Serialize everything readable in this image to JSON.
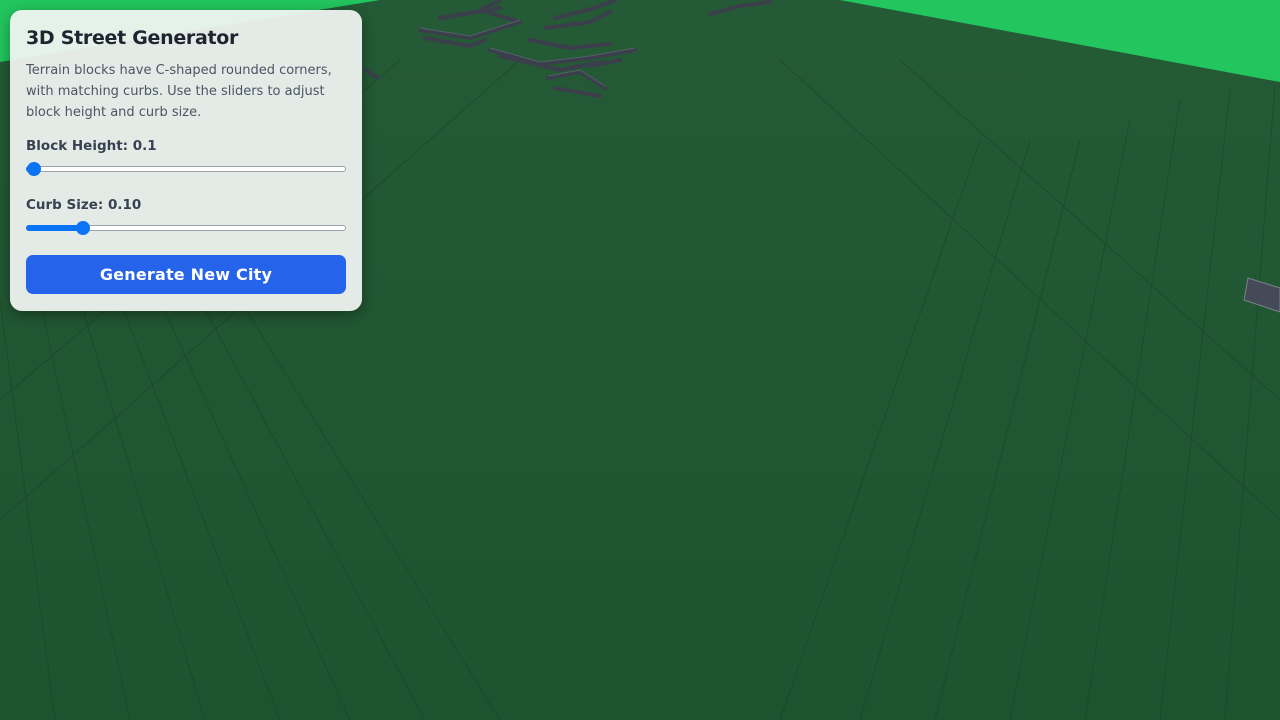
{
  "panel": {
    "title": "3D Street Generator",
    "description": "Terrain blocks have C-shaped rounded corners, with matching curbs. Use the sliders to adjust block height and curb size.",
    "block_height": {
      "label": "Block Height: 0.1",
      "value": 0.1,
      "fraction": 0.0
    },
    "curb_size": {
      "label": "Curb Size: 0.10",
      "value": 0.1,
      "fraction": 0.16
    },
    "generate_label": "Generate New City"
  },
  "colors": {
    "ground": "#1f5431",
    "sky_green": "#22c55e",
    "road": "#3a3f4b",
    "accent": "#2563eb",
    "slider_accent": "#0b74f5"
  }
}
